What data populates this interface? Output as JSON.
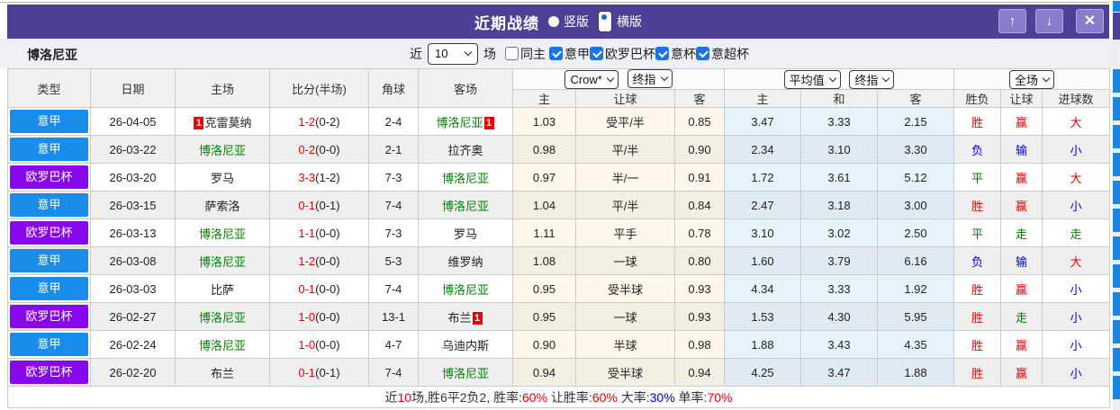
{
  "titlebar": {
    "title": "近期战绩",
    "radio_vertical": "竖版",
    "radio_horizontal": "横版",
    "buttons": {
      "up": "↑",
      "down": "↓",
      "close": "✕"
    }
  },
  "filterbar": {
    "team": "博洛尼亚",
    "recent_label": "近",
    "count_value": "10",
    "matches_label": "场",
    "checkboxes": [
      {
        "label": "同主",
        "checked": false
      },
      {
        "label": "意甲",
        "checked": true
      },
      {
        "label": "欧罗巴杯",
        "checked": true
      },
      {
        "label": "意杯",
        "checked": true
      },
      {
        "label": "意超杯",
        "checked": true
      }
    ]
  },
  "colors": {
    "titlebar_purple": "#4e4097",
    "league_serie_a_blue": "#1a8cea",
    "league_europa_purple": "#8808ee",
    "win_red": "#e60000",
    "lose_blue": "#0000e0",
    "draw_green": "#008000",
    "checkbox_blue": "#1a73e8",
    "strip_blue": "#1b86dc"
  },
  "table": {
    "card_text": "1",
    "headers": {
      "type": "类型",
      "date": "日期",
      "home": "主场",
      "score": "比分(半场)",
      "corner": "角球",
      "away": "客场",
      "odds_home": "主",
      "odds_handicap": "让球",
      "odds_away": "客",
      "avg_home": "主",
      "avg_draw": "和",
      "avg_away": "客",
      "res_wdl": "胜负",
      "res_handicap": "让球",
      "res_goals": "进球数"
    },
    "dropdowns": {
      "odds_source": "Crow*",
      "odds_time": "终指",
      "avg_source": "平均值",
      "avg_time": "终指",
      "scope": "全场"
    },
    "rows": [
      {
        "league": "意甲",
        "league_color": "blue",
        "date": "26-04-05",
        "home": {
          "name": "克雷莫纳",
          "green": false,
          "card": "left"
        },
        "score_ft": "1-2",
        "score_ht": "(0-2)",
        "corners": "2-4",
        "away": {
          "name": "博洛尼亚",
          "green": true,
          "card": "right"
        },
        "odds": {
          "home": "1.03",
          "handicap": "受平/半",
          "away": "0.85"
        },
        "avg": {
          "home": "3.47",
          "draw": "3.33",
          "away": "2.15"
        },
        "result": {
          "wdl": {
            "text": "胜",
            "color": "red"
          },
          "handicap": {
            "text": "赢",
            "color": "red"
          },
          "goals": {
            "text": "大",
            "color": "red"
          }
        }
      },
      {
        "league": "意甲",
        "league_color": "blue",
        "date": "26-03-22",
        "home": {
          "name": "博洛尼亚",
          "green": true,
          "card": null
        },
        "score_ft": "0-2",
        "score_ht": "(0-0)",
        "corners": "2-1",
        "away": {
          "name": "拉齐奥",
          "green": false,
          "card": null
        },
        "odds": {
          "home": "0.98",
          "handicap": "平/半",
          "away": "0.90"
        },
        "avg": {
          "home": "2.34",
          "draw": "3.10",
          "away": "3.30"
        },
        "result": {
          "wdl": {
            "text": "负",
            "color": "blue"
          },
          "handicap": {
            "text": "输",
            "color": "blue"
          },
          "goals": {
            "text": "小",
            "color": "blue"
          }
        }
      },
      {
        "league": "欧罗巴杯",
        "league_color": "purple",
        "date": "26-03-20",
        "home": {
          "name": "罗马",
          "green": false,
          "card": null
        },
        "score_ft": "3-3",
        "score_ht": "(1-2)",
        "corners": "7-3",
        "away": {
          "name": "博洛尼亚",
          "green": true,
          "card": null
        },
        "odds": {
          "home": "0.97",
          "handicap": "半/一",
          "away": "0.91"
        },
        "avg": {
          "home": "1.72",
          "draw": "3.61",
          "away": "5.12"
        },
        "result": {
          "wdl": {
            "text": "平",
            "color": "green"
          },
          "handicap": {
            "text": "赢",
            "color": "red"
          },
          "goals": {
            "text": "大",
            "color": "red"
          }
        }
      },
      {
        "league": "意甲",
        "league_color": "blue",
        "date": "26-03-15",
        "home": {
          "name": "萨索洛",
          "green": false,
          "card": null
        },
        "score_ft": "0-1",
        "score_ht": "(0-1)",
        "corners": "7-4",
        "away": {
          "name": "博洛尼亚",
          "green": true,
          "card": null
        },
        "odds": {
          "home": "1.04",
          "handicap": "平/半",
          "away": "0.84"
        },
        "avg": {
          "home": "2.47",
          "draw": "3.18",
          "away": "3.00"
        },
        "result": {
          "wdl": {
            "text": "胜",
            "color": "red"
          },
          "handicap": {
            "text": "赢",
            "color": "red"
          },
          "goals": {
            "text": "小",
            "color": "blue"
          }
        }
      },
      {
        "league": "欧罗巴杯",
        "league_color": "purple",
        "date": "26-03-13",
        "home": {
          "name": "博洛尼亚",
          "green": true,
          "card": null
        },
        "score_ft": "1-1",
        "score_ht": "(0-0)",
        "corners": "7-3",
        "away": {
          "name": "罗马",
          "green": false,
          "card": null
        },
        "odds": {
          "home": "1.11",
          "handicap": "平手",
          "away": "0.78"
        },
        "avg": {
          "home": "3.10",
          "draw": "3.02",
          "away": "2.50"
        },
        "result": {
          "wdl": {
            "text": "平",
            "color": "green"
          },
          "handicap": {
            "text": "走",
            "color": "green"
          },
          "goals": {
            "text": "走",
            "color": "green"
          }
        }
      },
      {
        "league": "意甲",
        "league_color": "blue",
        "date": "26-03-08",
        "home": {
          "name": "博洛尼亚",
          "green": true,
          "card": null
        },
        "score_ft": "1-2",
        "score_ht": "(0-0)",
        "corners": "5-3",
        "away": {
          "name": "维罗纳",
          "green": false,
          "card": null
        },
        "odds": {
          "home": "1.08",
          "handicap": "一球",
          "away": "0.80"
        },
        "avg": {
          "home": "1.60",
          "draw": "3.79",
          "away": "6.16"
        },
        "result": {
          "wdl": {
            "text": "负",
            "color": "blue"
          },
          "handicap": {
            "text": "输",
            "color": "blue"
          },
          "goals": {
            "text": "大",
            "color": "red"
          }
        }
      },
      {
        "league": "意甲",
        "league_color": "blue",
        "date": "26-03-03",
        "home": {
          "name": "比萨",
          "green": false,
          "card": null
        },
        "score_ft": "0-1",
        "score_ht": "(0-0)",
        "corners": "7-4",
        "away": {
          "name": "博洛尼亚",
          "green": true,
          "card": null
        },
        "odds": {
          "home": "0.95",
          "handicap": "受半球",
          "away": "0.93"
        },
        "avg": {
          "home": "4.34",
          "draw": "3.33",
          "away": "1.92"
        },
        "result": {
          "wdl": {
            "text": "胜",
            "color": "red"
          },
          "handicap": {
            "text": "赢",
            "color": "red"
          },
          "goals": {
            "text": "小",
            "color": "blue"
          }
        }
      },
      {
        "league": "欧罗巴杯",
        "league_color": "purple",
        "date": "26-02-27",
        "home": {
          "name": "博洛尼亚",
          "green": true,
          "card": null
        },
        "score_ft": "1-0",
        "score_ht": "(0-0)",
        "corners": "13-1",
        "away": {
          "name": "布兰",
          "green": false,
          "card": "right"
        },
        "odds": {
          "home": "0.95",
          "handicap": "一球",
          "away": "0.93"
        },
        "avg": {
          "home": "1.53",
          "draw": "4.30",
          "away": "5.95"
        },
        "result": {
          "wdl": {
            "text": "胜",
            "color": "red"
          },
          "handicap": {
            "text": "走",
            "color": "green"
          },
          "goals": {
            "text": "小",
            "color": "blue"
          }
        }
      },
      {
        "league": "意甲",
        "league_color": "blue",
        "date": "26-02-24",
        "home": {
          "name": "博洛尼亚",
          "green": true,
          "card": null
        },
        "score_ft": "1-0",
        "score_ht": "(0-0)",
        "corners": "4-7",
        "away": {
          "name": "乌迪内斯",
          "green": false,
          "card": null
        },
        "odds": {
          "home": "0.90",
          "handicap": "半球",
          "away": "0.98"
        },
        "avg": {
          "home": "1.88",
          "draw": "3.43",
          "away": "4.35"
        },
        "result": {
          "wdl": {
            "text": "胜",
            "color": "red"
          },
          "handicap": {
            "text": "赢",
            "color": "red"
          },
          "goals": {
            "text": "小",
            "color": "blue"
          }
        }
      },
      {
        "league": "欧罗巴杯",
        "league_color": "purple",
        "date": "26-02-20",
        "home": {
          "name": "布兰",
          "green": false,
          "card": null
        },
        "score_ft": "0-1",
        "score_ht": "(0-1)",
        "corners": "7-4",
        "away": {
          "name": "博洛尼亚",
          "green": true,
          "card": null
        },
        "odds": {
          "home": "0.94",
          "handicap": "受半球",
          "away": "0.94"
        },
        "avg": {
          "home": "4.25",
          "draw": "3.47",
          "away": "1.88"
        },
        "result": {
          "wdl": {
            "text": "胜",
            "color": "red"
          },
          "handicap": {
            "text": "赢",
            "color": "red"
          },
          "goals": {
            "text": "小",
            "color": "blue"
          }
        }
      }
    ]
  },
  "footer": {
    "segments": [
      {
        "text": "近",
        "color": null
      },
      {
        "text": "10",
        "color": "red"
      },
      {
        "text": "场,胜6平2负2, 胜率:",
        "color": null
      },
      {
        "text": "60%",
        "color": "red"
      },
      {
        "text": " 让胜率:",
        "color": null
      },
      {
        "text": "60%",
        "color": "red"
      },
      {
        "text": " 大率:",
        "color": null
      },
      {
        "text": "30%",
        "color": "blue"
      },
      {
        "text": " 单率:",
        "color": null
      },
      {
        "text": "70%",
        "color": "red"
      }
    ]
  }
}
